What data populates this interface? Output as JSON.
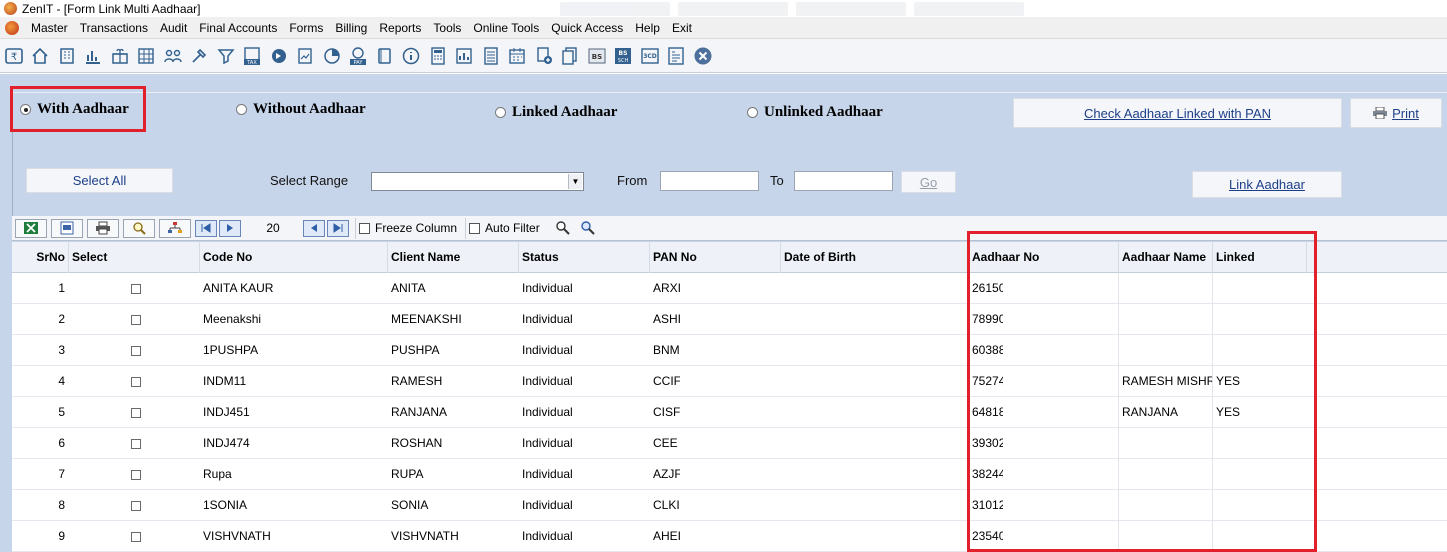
{
  "window": {
    "title": "ZenIT - [Form Link Multi Aadhaar]"
  },
  "menu": [
    "Master",
    "Transactions",
    "Audit",
    "Final Accounts",
    "Forms",
    "Billing",
    "Reports",
    "Tools",
    "Online Tools",
    "Quick Access",
    "Help",
    "Exit"
  ],
  "toolbar_icons": [
    "rupee-icon",
    "home-icon",
    "building-icon",
    "bar-chart-icon",
    "gift-icon",
    "grid-icon",
    "users-icon",
    "tools-icon",
    "filter-icon",
    "tax-icon",
    "arrow-circle-icon",
    "report-icon",
    "pie-icon",
    "pay-icon",
    "book-icon",
    "info-icon",
    "calculator-icon",
    "chart-doc-icon",
    "calculator2-icon",
    "calendar-icon",
    "add-page-icon",
    "pages-icon",
    "bs-icon",
    "bs-sch-icon",
    "3cd-icon",
    "form-icon",
    "close-icon"
  ],
  "toolbar_badges": {
    "tax": "TAX",
    "pay": "PAY",
    "bs": "BS",
    "bs_sch": "SCH",
    "cd": "3CD"
  },
  "options": {
    "with_aadhaar": "With Aadhaar",
    "without_aadhaar": "Without Aadhaar",
    "linked_aadhaar": "Linked Aadhaar",
    "unlinked_aadhaar": "Unlinked Aadhaar",
    "selected": "with_aadhaar"
  },
  "buttons": {
    "check_linked": "Check Aadhaar Linked with PAN",
    "print": "Print",
    "select_all": "Select All",
    "go": "Go",
    "link_aadhaar": "Link Aadhaar"
  },
  "range": {
    "label": "Select Range",
    "from_label": "From",
    "to_label": "To",
    "from_value": "",
    "to_value": "",
    "selected": ""
  },
  "grid_toolbar": {
    "page_size": "20",
    "freeze_column": "Freeze Column",
    "auto_filter": "Auto Filter"
  },
  "columns": [
    "SrNo",
    "Select",
    "Code No",
    "Client Name",
    "Status",
    "PAN No",
    "Date of Birth",
    "Aadhaar No",
    "Aadhaar Name",
    "Linked"
  ],
  "rows": [
    {
      "srno": "1",
      "code": "ANITA KAUR",
      "name": "ANITA",
      "status": "Individual",
      "pan": "ARXI",
      "dob": "",
      "aadhaar": "26150",
      "aname": "",
      "linked": ""
    },
    {
      "srno": "2",
      "code": "Meenakshi",
      "name": "MEENAKSHI",
      "status": "Individual",
      "pan": "ASHI",
      "dob": "",
      "aadhaar": "78990",
      "aname": "",
      "linked": ""
    },
    {
      "srno": "3",
      "code": "1PUSHPA",
      "name": "PUSHPA",
      "status": "Individual",
      "pan": "BNM",
      "dob": "",
      "aadhaar": "60388",
      "aname": "",
      "linked": ""
    },
    {
      "srno": "4",
      "code": "INDM11",
      "name": "RAMESH",
      "status": "Individual",
      "pan": "CCIF",
      "dob": "",
      "aadhaar": "75274",
      "aname": "RAMESH MISHR",
      "linked": "YES"
    },
    {
      "srno": "5",
      "code": "INDJ451",
      "name": "RANJANA",
      "status": "Individual",
      "pan": "CISF",
      "dob": "",
      "aadhaar": "64818",
      "aname": "RANJANA",
      "linked": "YES"
    },
    {
      "srno": "6",
      "code": "INDJ474",
      "name": "ROSHAN",
      "status": "Individual",
      "pan": "CEE",
      "dob": "",
      "aadhaar": "39302",
      "aname": "",
      "linked": ""
    },
    {
      "srno": "7",
      "code": "Rupa",
      "name": "RUPA",
      "status": "Individual",
      "pan": "AZJF",
      "dob": "",
      "aadhaar": "38244",
      "aname": "",
      "linked": ""
    },
    {
      "srno": "8",
      "code": "1SONIA",
      "name": "SONIA",
      "status": "Individual",
      "pan": "CLKI",
      "dob": "",
      "aadhaar": "31012",
      "aname": "",
      "linked": ""
    },
    {
      "srno": "9",
      "code": "VISHVNATH",
      "name": "VISHVNATH",
      "status": "Individual",
      "pan": "AHEI",
      "dob": "",
      "aadhaar": "23540",
      "aname": "",
      "linked": ""
    }
  ],
  "colors": {
    "highlight": "#e2202c",
    "panel_bg": "#c7d5ea",
    "link_text": "#1d3f88"
  }
}
